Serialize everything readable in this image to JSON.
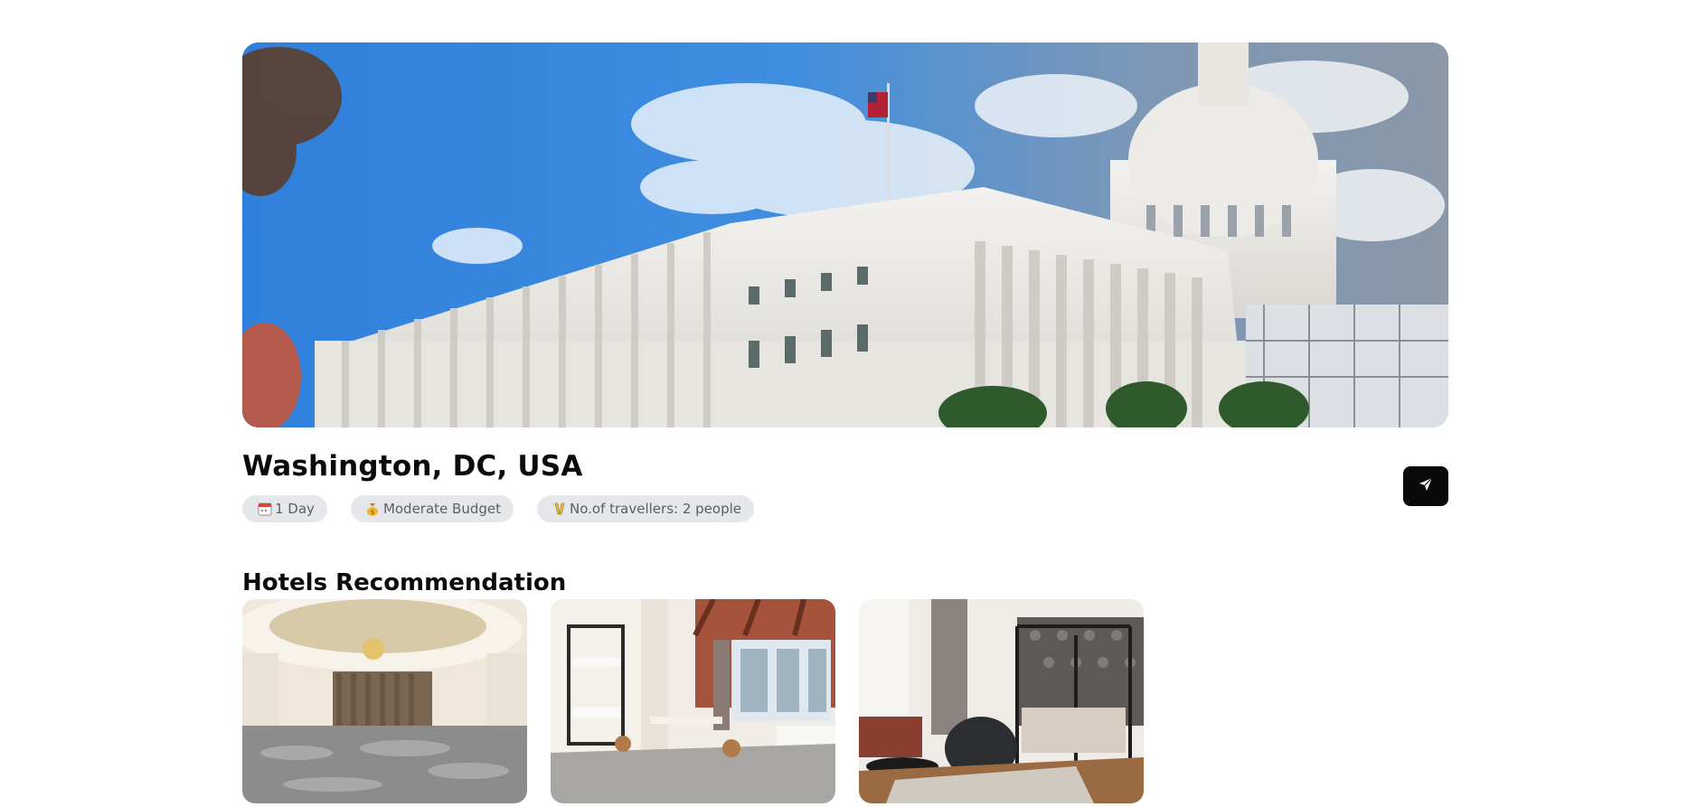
{
  "trip": {
    "location": "Washington, DC, USA",
    "hero_image": "us-capitol-building-photo",
    "chips": [
      {
        "icon": "calendar-icon",
        "label": "1 Day"
      },
      {
        "icon": "money-bag-icon",
        "label": "Moderate Budget"
      },
      {
        "icon": "travellers-icon",
        "label": "No.of travellers: 2 people"
      }
    ],
    "share_icon": "send-icon"
  },
  "hotels": {
    "heading": "Hotels Recommendation",
    "items": [
      {
        "image": "hotel-ballroom-photo"
      },
      {
        "image": "hotel-bunk-room-photo"
      },
      {
        "image": "hotel-canopy-bedroom-photo"
      }
    ]
  },
  "colors": {
    "chip_bg": "#e5e7eb",
    "chip_text": "#5b5f66",
    "button_bg": "#0a0a0a",
    "title_text": "#0b0b0b"
  }
}
